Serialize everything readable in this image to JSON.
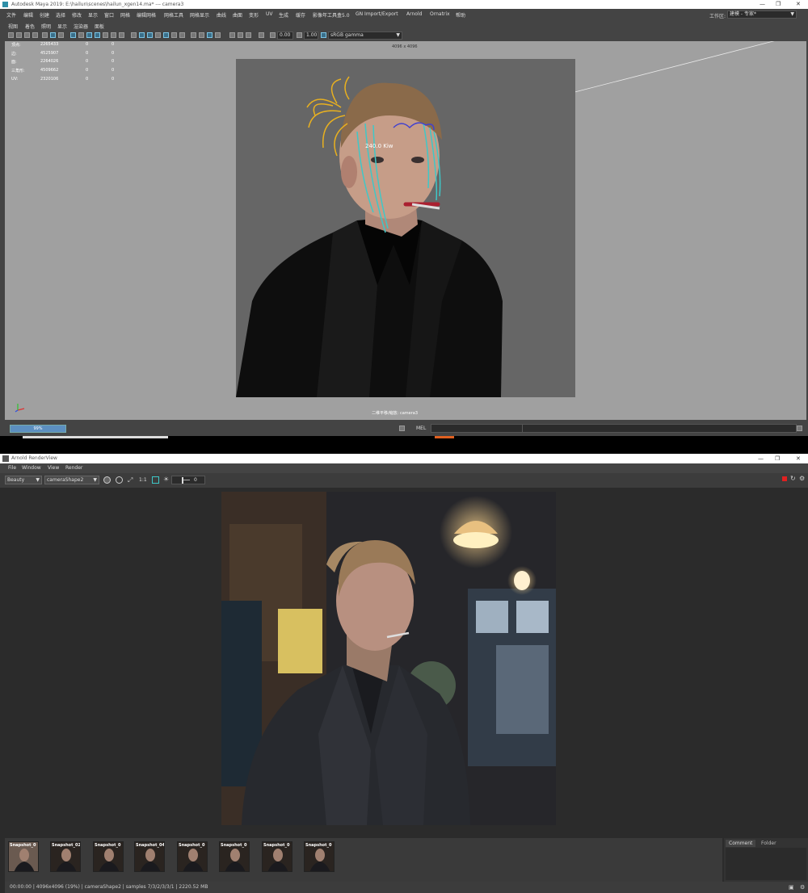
{
  "maya": {
    "title": "Autodesk Maya 2019: E:\\hailun\\scenes\\hailun_xgen14.ma*  ---  camera3",
    "window_controls": [
      "—",
      "❐",
      "✕"
    ],
    "menu": [
      "文件",
      "编辑",
      "创建",
      "选择",
      "修改",
      "显示",
      "窗口",
      "网格",
      "编辑网格",
      "网格工具",
      "网格显示",
      "曲线",
      "曲面",
      "变形",
      "UV",
      "生成",
      "缓存",
      "影像年工具盒5.0",
      "GN Import/Export",
      "Arnold",
      "Ornatrix",
      "帮助"
    ],
    "workspace_label": "工作区:",
    "workspace_value": "建模 - 专家*",
    "viewport_menu": [
      "视图",
      "着色",
      "照明",
      "显示",
      "渲染器",
      "面板"
    ],
    "toolbar": {
      "field1": "0.00",
      "field2": "1.00",
      "colorspace": "sRGB gamma"
    },
    "resolution_label": "4096 x 4096",
    "hud": [
      {
        "label": "顶点:",
        "v1": "2265433",
        "v2": "0",
        "v3": "0"
      },
      {
        "label": "边:",
        "v1": "4525907",
        "v2": "0",
        "v3": "0"
      },
      {
        "label": "面:",
        "v1": "2264026",
        "v2": "0",
        "v3": "0"
      },
      {
        "label": "三角形:",
        "v1": "4509662",
        "v2": "0",
        "v3": "0"
      },
      {
        "label": "UV:",
        "v1": "2320106",
        "v2": "0",
        "v3": "0"
      }
    ],
    "gate_text": "240.0 Kiw",
    "camera_label": "二维平移/缩放: camera3",
    "progress": "99%",
    "progress_value": 0.99,
    "mel_label": "MEL"
  },
  "arnold": {
    "title": "Arnold RenderView",
    "window_controls": [
      "—",
      "❐",
      "✕"
    ],
    "menu": [
      "File",
      "Window",
      "View",
      "Render"
    ],
    "aov": "Beauty",
    "camera": "cameraShape2",
    "ratio": "1:1",
    "exposure": "0",
    "snapshots": [
      "Snapshot_0",
      "Snapshot_02",
      "Snapshot_0",
      "Snapshot_04",
      "Snapshot_0",
      "Snapshot_0",
      "Snapshot_0",
      "Snapshot_0"
    ],
    "tabs": [
      "Comment",
      "Folder"
    ],
    "status": "00:00:00 | 4096x4096 (19%) | cameraShape2 | samples 7/3/2/3/3/1 | 2220.52 MB"
  },
  "colors": {
    "maya_bg": "#444444",
    "viewport_bg": "#a0a0a0",
    "accent_blue": "#5c8fc0",
    "hair_guides_yellow": "#e8b020",
    "hair_guides_cyan": "#3ec8c8",
    "arnold_bg": "#2b2b2b"
  }
}
